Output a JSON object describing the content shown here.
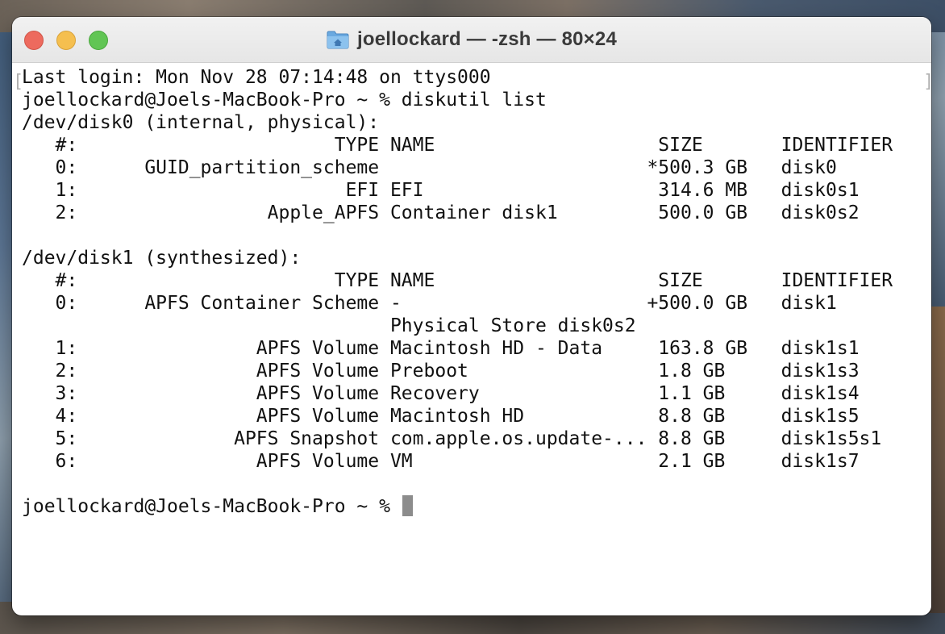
{
  "window": {
    "title": "joellockard — -zsh — 80×24",
    "colors": {
      "close": "#ed6a5e",
      "minimize": "#f5bf4f",
      "maximize": "#61c554",
      "cursor": "#8c8c8c"
    }
  },
  "terminal": {
    "lines": [
      "Last login: Mon Nov 28 07:14:48 on ttys000",
      "joellockard@Joels-MacBook-Pro ~ % diskutil list",
      "/dev/disk0 (internal, physical):",
      "   #:                       TYPE NAME                    SIZE       IDENTIFIER",
      "   0:      GUID_partition_scheme                        *500.3 GB   disk0",
      "   1:                        EFI EFI                     314.6 MB   disk0s1",
      "   2:                 Apple_APFS Container disk1         500.0 GB   disk0s2",
      "",
      "/dev/disk1 (synthesized):",
      "   #:                       TYPE NAME                    SIZE       IDENTIFIER",
      "   0:      APFS Container Scheme -                      +500.0 GB   disk1",
      "                                 Physical Store disk0s2",
      "   1:                APFS Volume Macintosh HD - Data     163.8 GB   disk1s1",
      "   2:                APFS Volume Preboot                 1.8 GB     disk1s3",
      "   3:                APFS Volume Recovery                1.1 GB     disk1s4",
      "   4:                APFS Volume Macintosh HD            8.8 GB     disk1s5",
      "   5:              APFS Snapshot com.apple.os.update-... 8.8 GB     disk1s5s1",
      "   6:                APFS Volume VM                      2.1 GB     disk1s7",
      "",
      "joellockard@Joels-MacBook-Pro ~ % "
    ],
    "left_bracket": "[",
    "right_bracket": "]"
  },
  "icons": {
    "title_icon": "home-folder-icon"
  }
}
